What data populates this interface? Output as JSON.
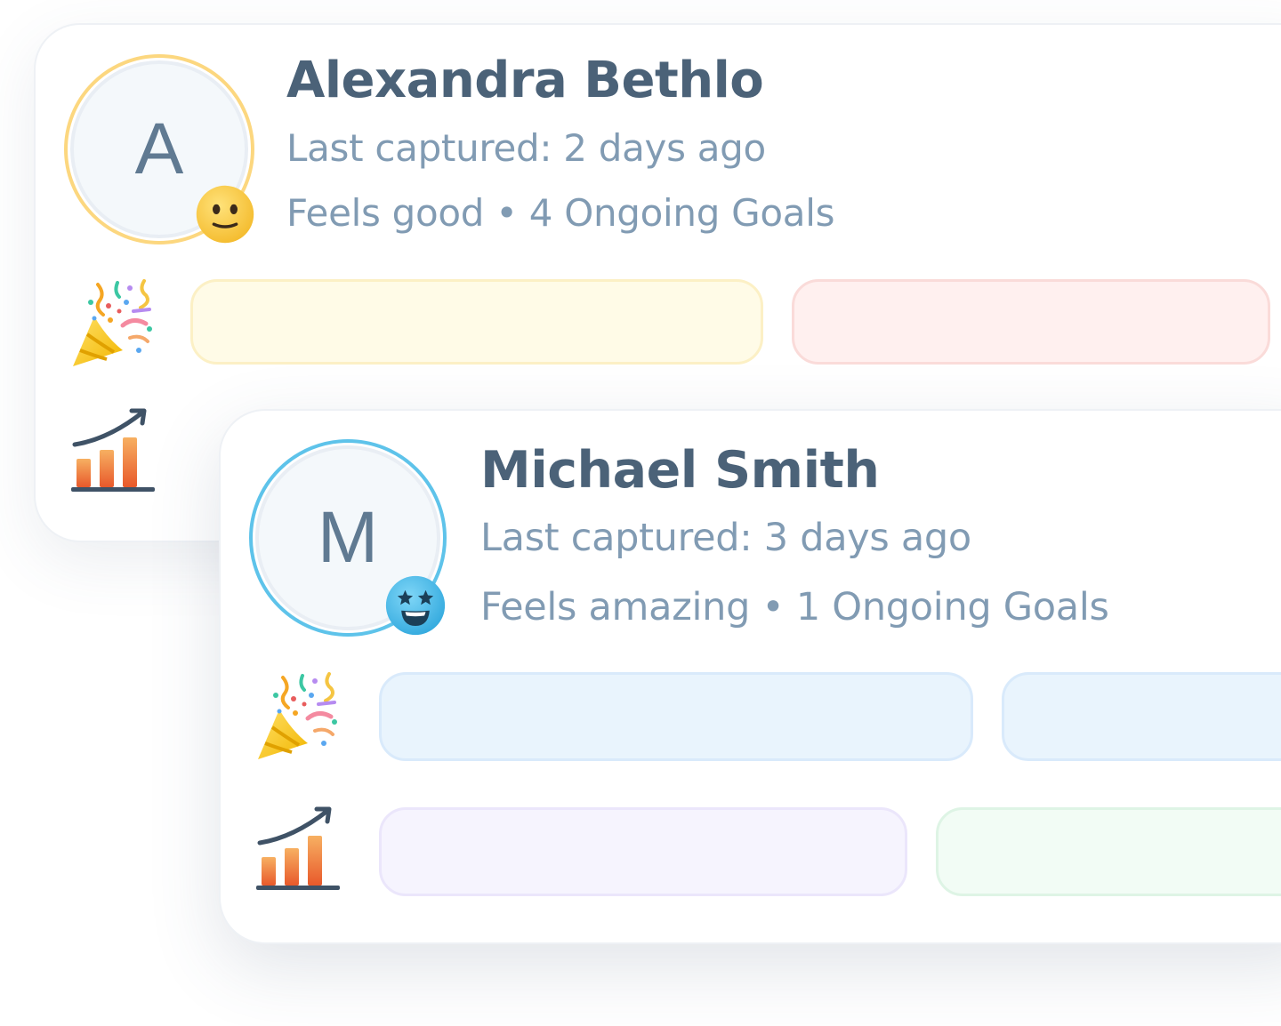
{
  "profiles": [
    {
      "initial": "A",
      "name": "Alexandra Bethlo",
      "last_captured": "Last captured: 2 days ago",
      "status_line": "Feels good • 4 Ongoing Goals",
      "ring_color": "#fcd77f",
      "mood_icon": "neutral-smile-face-icon"
    },
    {
      "initial": "M",
      "name": "Michael Smith",
      "last_captured": "Last captured: 3 days ago",
      "status_line": "Feels amazing • 1 Ongoing Goals",
      "ring_color": "#5ec3ea",
      "mood_icon": "star-eyes-face-icon"
    }
  ],
  "icons": {
    "celebration": "party-popper-icon",
    "progress": "bar-chart-growth-icon"
  },
  "colors": {
    "name_text": "#4b6278",
    "meta_text": "#819bb3",
    "pill_yellow": "#fffbe7",
    "pill_red": "#fff0ef",
    "pill_blue": "#e9f4fd",
    "pill_purple": "#f6f4fe",
    "pill_green": "#f2fcf5"
  }
}
